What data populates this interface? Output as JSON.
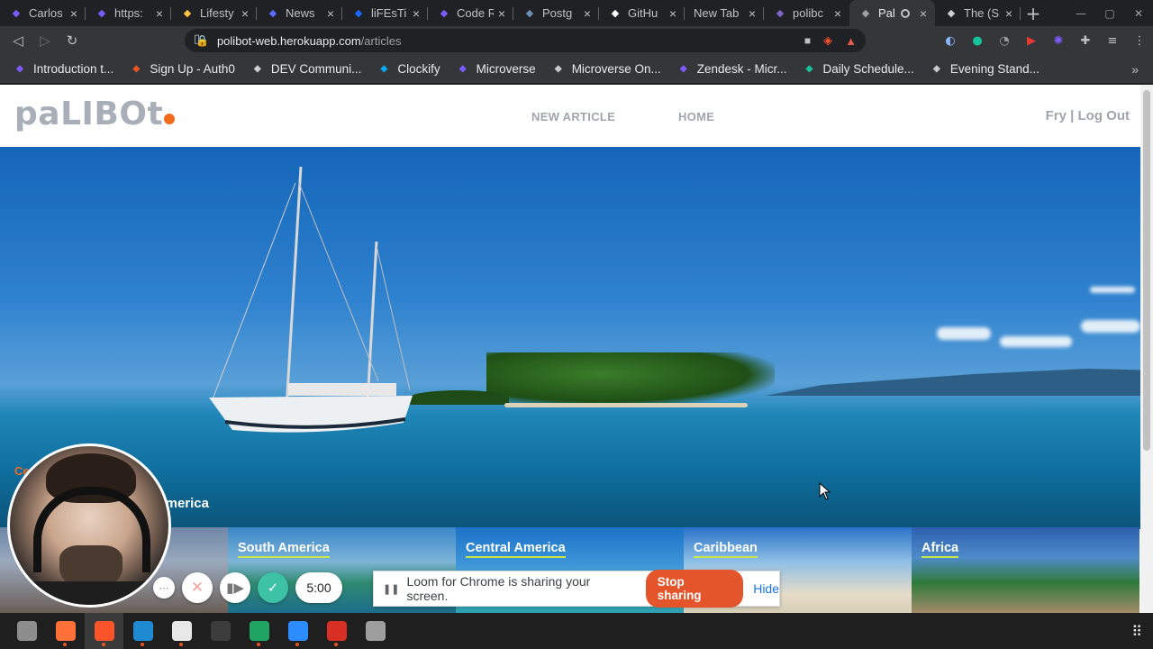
{
  "browser": {
    "tabs": [
      {
        "title": "Carlos",
        "icon": "microverse-icon",
        "color": "#7c5cff"
      },
      {
        "title": "https:",
        "icon": "microverse-icon",
        "color": "#7c5cff"
      },
      {
        "title": "Lifesty",
        "icon": "pencil-icon",
        "color": "#f5c542"
      },
      {
        "title": "News",
        "icon": "react-icon",
        "color": "#5b6cff"
      },
      {
        "title": "liFEsTi",
        "icon": "behance-icon",
        "color": "#1769ff"
      },
      {
        "title": "Code R",
        "icon": "microverse-icon",
        "color": "#7c5cff"
      },
      {
        "title": "Postg",
        "icon": "postgres-icon",
        "color": "#6b8fb4"
      },
      {
        "title": "GitHu",
        "icon": "github-icon",
        "color": "#ffffff"
      },
      {
        "title": "New Tab",
        "icon": "",
        "color": ""
      },
      {
        "title": "polibc",
        "icon": "heroku-icon",
        "color": "#8064c6"
      },
      {
        "title": "Pal",
        "icon": "globe-icon",
        "color": "#9aa0a6"
      },
      {
        "title": "The (S",
        "icon": "link-icon",
        "color": "#d0d0d0"
      }
    ],
    "active_tab_index": 10,
    "address": {
      "host": "polibot-web.herokuapp.com",
      "path": "/articles"
    },
    "bookmarks": [
      {
        "label": "Introduction t...",
        "icon": "microverse-icon",
        "color": "#7c5cff"
      },
      {
        "label": "Sign Up - Auth0",
        "icon": "auth0-icon",
        "color": "#eb5424"
      },
      {
        "label": "DEV Communi...",
        "icon": "globe-icon",
        "color": "#cfcfcf"
      },
      {
        "label": "Clockify",
        "icon": "clockify-icon",
        "color": "#03a9f4"
      },
      {
        "label": "Microverse",
        "icon": "microverse-icon",
        "color": "#7c5cff"
      },
      {
        "label": "Microverse On...",
        "icon": "microverse-icon",
        "color": "#c9c9c9"
      },
      {
        "label": "Zendesk - Micr...",
        "icon": "microverse-icon",
        "color": "#7c5cff"
      },
      {
        "label": "Daily Schedule...",
        "icon": "m-icon",
        "color": "#15c39a"
      },
      {
        "label": "Evening Stand...",
        "icon": "microverse-icon",
        "color": "#c9c9c9"
      }
    ]
  },
  "site": {
    "logo_main": "paLIBOt",
    "nav": {
      "new_article": "NEW ARTICLE",
      "home": "HOME"
    },
    "user_links": "Fry | Log Out",
    "hero": {
      "category": "Ce",
      "category_tail": "h",
      "title_tail": "l America"
    },
    "categories": [
      {
        "label": "South America",
        "bg": "linear-gradient(180deg,#3b86c9 0%,#7db4d8 40%,#2f8a6f 65%,#1d6d8c 100%)"
      },
      {
        "label": "Central America",
        "bg": "linear-gradient(180deg,#1b72c7 0%,#3f97d9 45%,#5cc3d4 70%,#2b9fb0 100%)"
      },
      {
        "label": "Caribbean",
        "bg": "linear-gradient(180deg,#2a72c8 0%,#8ebfe6 40%,#e6dcc8 78%,#d8cfb8 100%)"
      },
      {
        "label": "Africa",
        "bg": "linear-gradient(180deg,#2d5fae 0%,#4f8bc9 35%,#2f7a3a 65%,#a58b6a 100%)"
      }
    ],
    "partial_first_category_bg": "linear-gradient(180deg,#6e86a6 0%,#9aa9bd 40%,#6a5e56 100%)"
  },
  "loom": {
    "timer": "5:00",
    "share_message": "Loom for Chrome is sharing your screen.",
    "stop_label": "Stop sharing",
    "hide_label": "Hide"
  },
  "taskbar": {
    "apps": [
      {
        "name": "files-app",
        "color": "#8d8d8d"
      },
      {
        "name": "firefox-app",
        "color": "#ff7139"
      },
      {
        "name": "brave-app",
        "color": "#fb542b"
      },
      {
        "name": "vscode-app",
        "color": "#1f8ad2"
      },
      {
        "name": "slack-app",
        "color": "#e8e8e8"
      },
      {
        "name": "terminal-app",
        "color": "#3c3c3c"
      },
      {
        "name": "sheets-app",
        "color": "#1fa463"
      },
      {
        "name": "zoom-app",
        "color": "#2d8cff"
      },
      {
        "name": "screenshot-app",
        "color": "#d93025"
      },
      {
        "name": "utility-app",
        "color": "#9e9e9e"
      }
    ]
  }
}
